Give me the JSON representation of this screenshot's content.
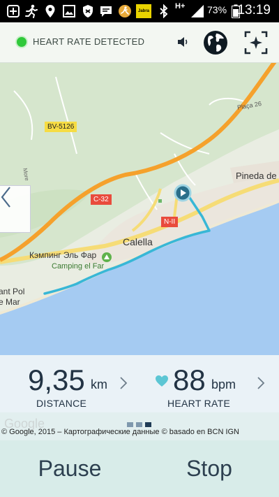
{
  "statusbar": {
    "battery_percent": "73%",
    "network": "H+",
    "time": "13:19",
    "jabra_label": "Jabra",
    "icons": [
      "plus-icon",
      "runner-icon",
      "location-icon",
      "image-icon",
      "shield-icon",
      "message-icon",
      "runkeeper-icon",
      "jabra-icon",
      "bluetooth-icon",
      "signal-icon",
      "battery-icon"
    ]
  },
  "header": {
    "heart_rate_status": "HEART RATE DETECTED",
    "icons": [
      "speaker-icon",
      "globe-icon",
      "center-location-icon"
    ],
    "status_color": "#2fc93a"
  },
  "map": {
    "labels": {
      "bv5126": "BV-5126",
      "c32": "C-32",
      "n2": "N-II",
      "calella": "Calella",
      "pineda": "Pineda de M",
      "kemping": "Кэмпинг Эль Фар",
      "camping": "Camping el Far",
      "santpol1": "ant Pol",
      "santpol2": "e Mar",
      "placa": "Plaça 26",
      "more": "More"
    },
    "route_color": "#38b7d6",
    "highway_color": "#f5a12c"
  },
  "stats": {
    "distance_value": "9,35",
    "distance_unit": "km",
    "distance_label": "DISTANCE",
    "hr_value": "88",
    "hr_unit": "bpm",
    "hr_label": "HEART RATE"
  },
  "attribution": {
    "google": "Google",
    "text": "© Google, 2015 – Картографические данные © basado en BCN IGN"
  },
  "pager": {
    "pages": 3,
    "active_index": 2
  },
  "controls": {
    "pause_label": "Pause",
    "stop_label": "Stop"
  }
}
